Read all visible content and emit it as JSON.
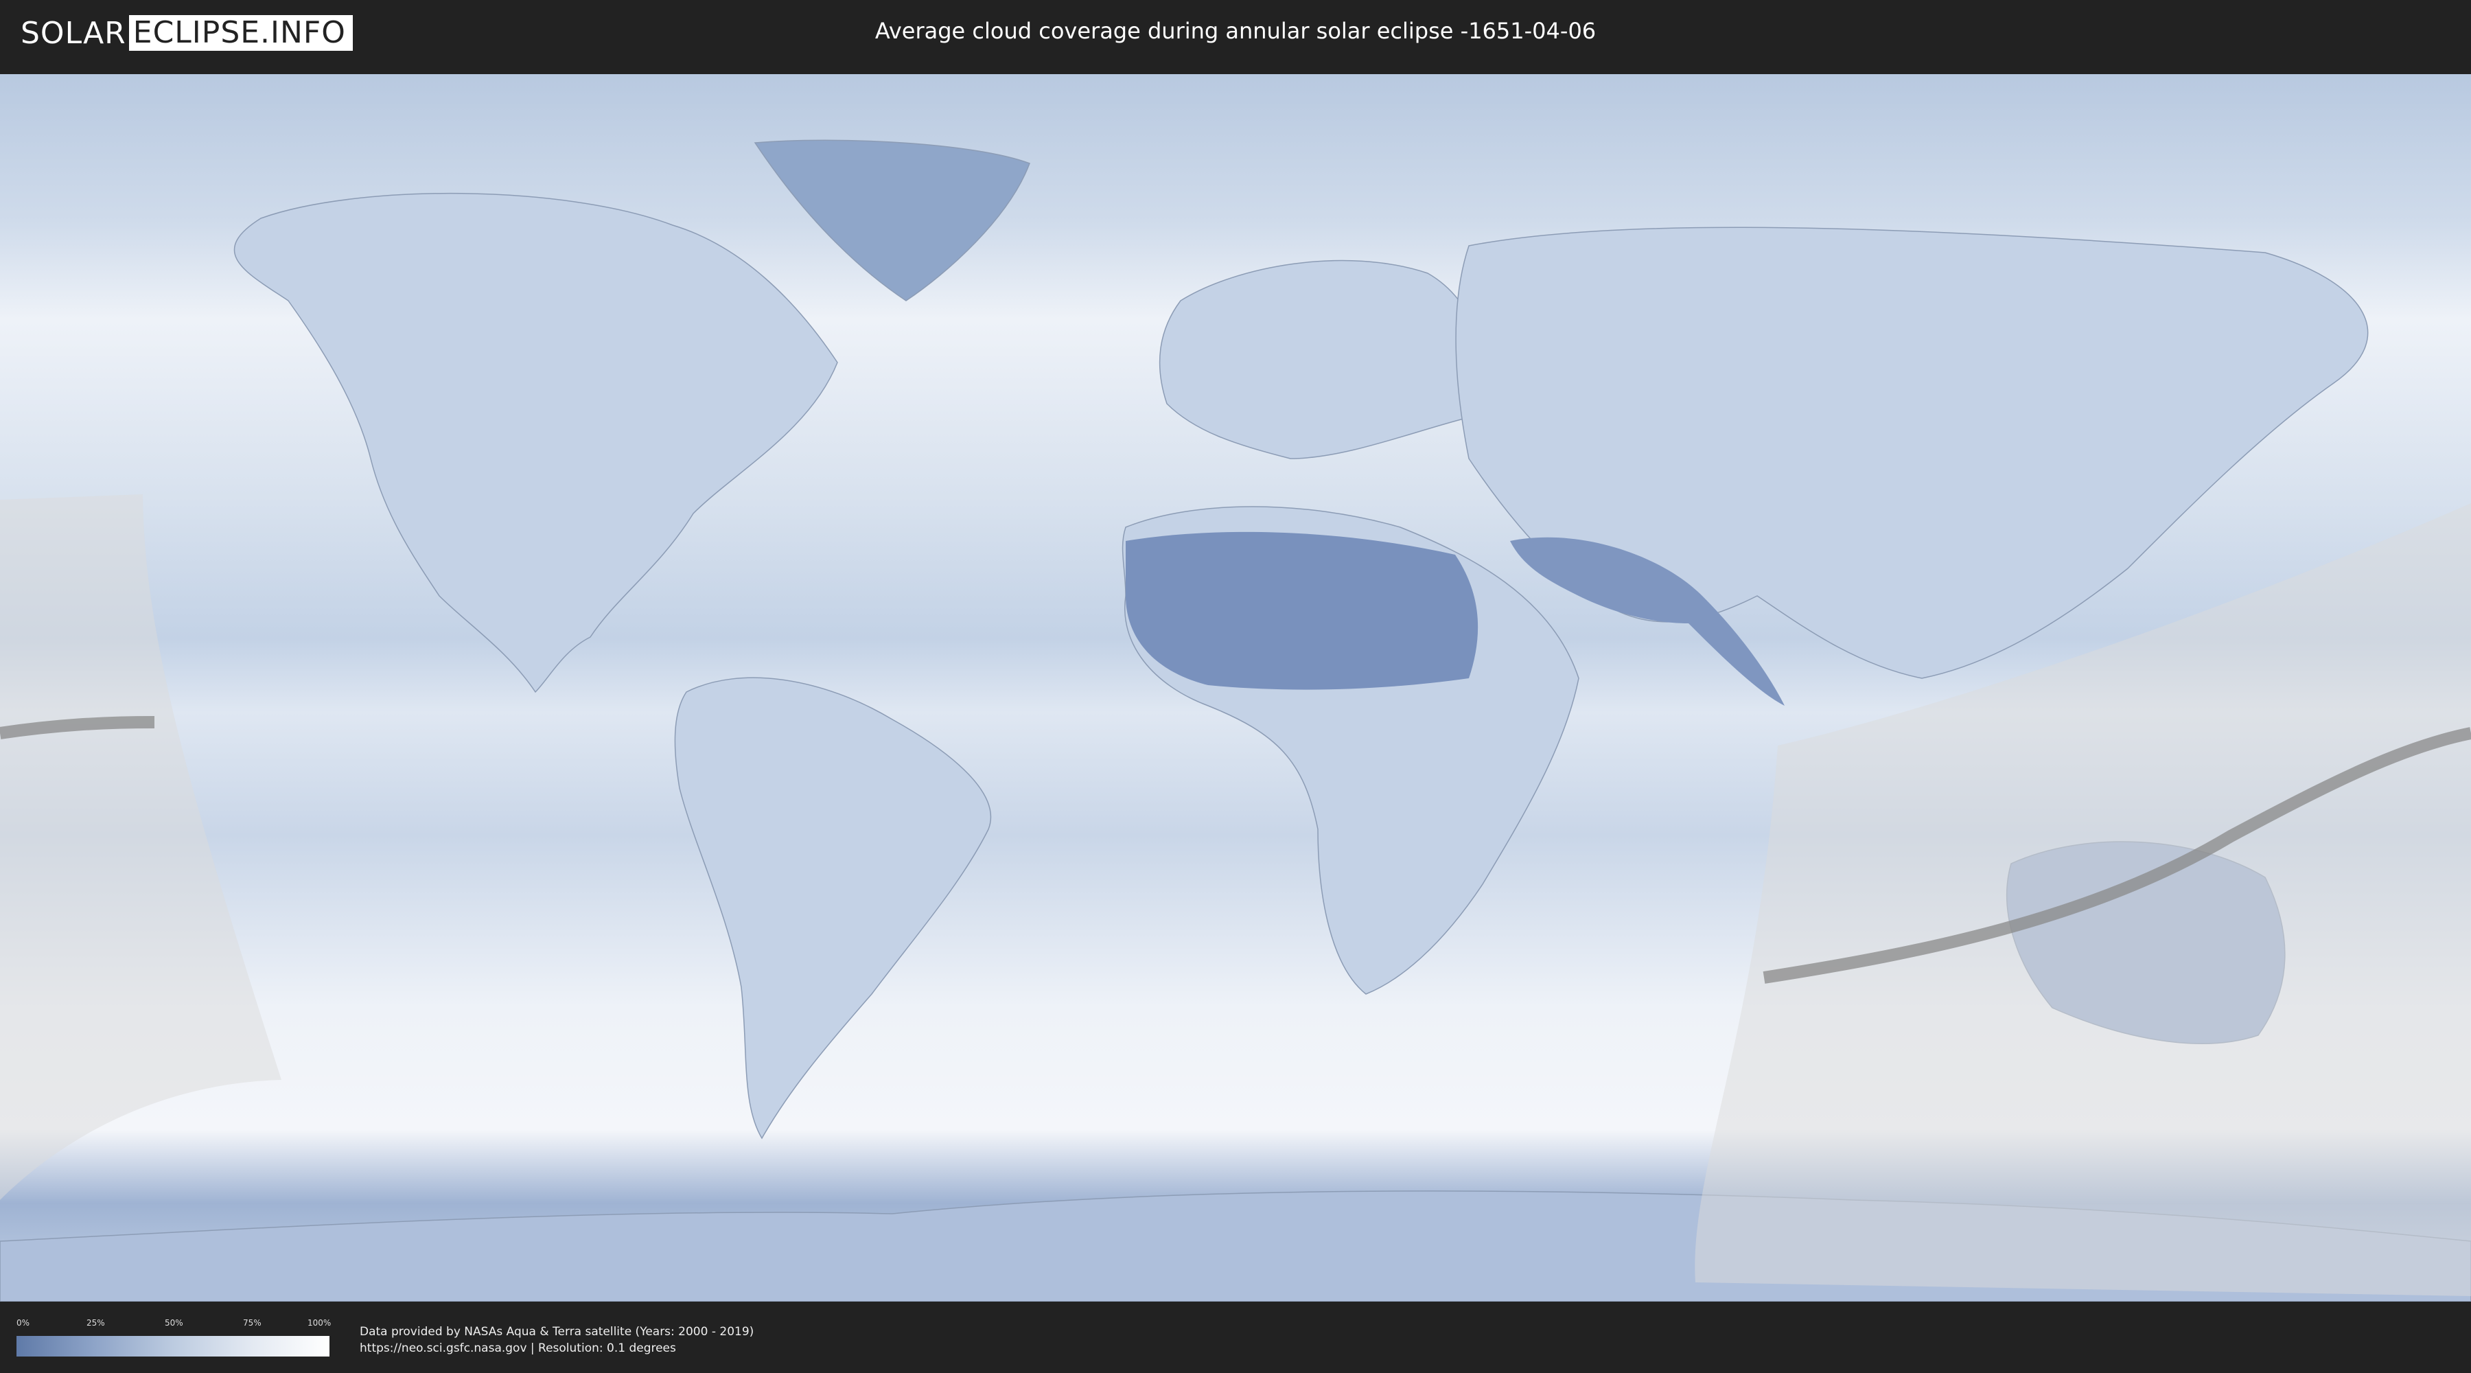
{
  "header": {
    "logo_left": "SOLAR",
    "logo_right": "ECLIPSE.INFO",
    "title": "Average cloud coverage during annular solar eclipse -1651-04-06"
  },
  "legend": {
    "ticks": [
      "0%",
      "25%",
      "50%",
      "75%",
      "100%"
    ],
    "gradient_colors": [
      "#5f7aa8",
      "#8ea4c8",
      "#bccbe0",
      "#e3e9f2",
      "#ffffff"
    ]
  },
  "footer": {
    "credit_line1": "Data provided by NASAs Aqua & Terra satellite (Years: 2000 - 2019)",
    "credit_line2": "https://neo.sci.gsfc.nasa.gov | Resolution: 0.1 degrees"
  },
  "colors": {
    "background": "#222222",
    "clear_sky": "#6e88b5",
    "cloudy": "#ffffff",
    "shadow_band": "#dcdcdc",
    "central_line": "#8a8a8a"
  }
}
